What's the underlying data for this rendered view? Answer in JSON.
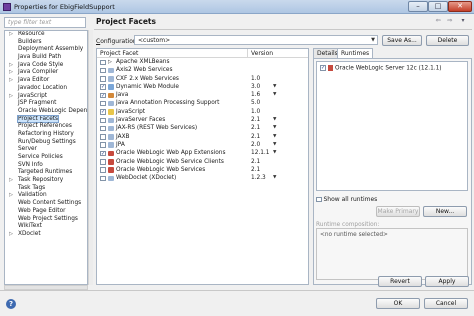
{
  "window": {
    "title": "Properties for EbigFieldSupport",
    "min": "–",
    "max": "□",
    "close": "✕"
  },
  "filter": {
    "placeholder": "type filter text"
  },
  "nav": {
    "items": [
      {
        "label": "Resource",
        "twisty": "▷"
      },
      {
        "label": "Builders",
        "twisty": ""
      },
      {
        "label": "Deployment Assembly",
        "twisty": ""
      },
      {
        "label": "Java Build Path",
        "twisty": ""
      },
      {
        "label": "Java Code Style",
        "twisty": "▷"
      },
      {
        "label": "Java Compiler",
        "twisty": "▷"
      },
      {
        "label": "Java Editor",
        "twisty": "▷"
      },
      {
        "label": "Javadoc Location",
        "twisty": ""
      },
      {
        "label": "JavaScript",
        "twisty": "▷"
      },
      {
        "label": "JSP Fragment",
        "twisty": ""
      },
      {
        "label": "Oracle WebLogic Depender",
        "twisty": ""
      },
      {
        "label": "Project Facets",
        "twisty": "",
        "selected": true
      },
      {
        "label": "Project References",
        "twisty": ""
      },
      {
        "label": "Refactoring History",
        "twisty": ""
      },
      {
        "label": "Run/Debug Settings",
        "twisty": ""
      },
      {
        "label": "Server",
        "twisty": ""
      },
      {
        "label": "Service Policies",
        "twisty": ""
      },
      {
        "label": "SVN Info",
        "twisty": ""
      },
      {
        "label": "Targeted Runtimes",
        "twisty": ""
      },
      {
        "label": "Task Repository",
        "twisty": "▷"
      },
      {
        "label": "Task Tags",
        "twisty": ""
      },
      {
        "label": "Validation",
        "twisty": "▷"
      },
      {
        "label": "Web Content Settings",
        "twisty": ""
      },
      {
        "label": "Web Page Editor",
        "twisty": ""
      },
      {
        "label": "Web Project Settings",
        "twisty": ""
      },
      {
        "label": "WikiText",
        "twisty": ""
      },
      {
        "label": "XDoclet",
        "twisty": "▷"
      }
    ]
  },
  "header": {
    "title": "Project Facets",
    "back_icon": "⇦",
    "forward_icon": "⇨",
    "menu_icon": "▾"
  },
  "configuration": {
    "label_prefix": "C",
    "label_rest": "onfiguration:",
    "value": "<custom>",
    "arrow": "▼",
    "save_as": "Save As...",
    "delete": "Delete"
  },
  "facets": {
    "col_facet": "Project Facet",
    "col_version": "Version",
    "rows": [
      {
        "expander": "▷",
        "checked": false,
        "icon": "",
        "name": "Apache XMLBeans",
        "version": "",
        "dd": ""
      },
      {
        "expander": "",
        "checked": false,
        "icon": "",
        "name": "Axis2 Web Services",
        "version": "",
        "dd": ""
      },
      {
        "expander": "",
        "checked": false,
        "icon": "",
        "name": "CXF 2.x Web Services",
        "version": "1.0",
        "dd": ""
      },
      {
        "expander": "",
        "checked": true,
        "icon": "web",
        "name": "Dynamic Web Module",
        "version": "3.0",
        "dd": "▼"
      },
      {
        "expander": "",
        "checked": true,
        "icon": "java",
        "name": "Java",
        "version": "1.6",
        "dd": "▼"
      },
      {
        "expander": "",
        "checked": false,
        "icon": "",
        "name": "Java Annotation Processing Support",
        "version": "5.0",
        "dd": ""
      },
      {
        "expander": "",
        "checked": true,
        "icon": "js",
        "name": "JavaScript",
        "version": "1.0",
        "dd": ""
      },
      {
        "expander": "",
        "checked": false,
        "icon": "",
        "name": "JavaServer Faces",
        "version": "2.1",
        "dd": "▼"
      },
      {
        "expander": "",
        "checked": false,
        "icon": "",
        "name": "JAX-RS (REST Web Services)",
        "version": "2.1",
        "dd": "▼"
      },
      {
        "expander": "",
        "checked": false,
        "icon": "",
        "name": "JAXB",
        "version": "2.1",
        "dd": "▼"
      },
      {
        "expander": "",
        "checked": false,
        "icon": "",
        "name": "JPA",
        "version": "2.0",
        "dd": "▼"
      },
      {
        "expander": "",
        "checked": true,
        "icon": "ora",
        "name": "Oracle WebLogic Web App Extensions",
        "version": "12.1.1",
        "dd": "▼"
      },
      {
        "expander": "",
        "checked": false,
        "icon": "ora",
        "name": "Oracle WebLogic Web Service Clients",
        "version": "2.1",
        "dd": ""
      },
      {
        "expander": "",
        "checked": false,
        "icon": "ora",
        "name": "Oracle WebLogic Web Services",
        "version": "2.1",
        "dd": ""
      },
      {
        "expander": "",
        "checked": false,
        "icon": "",
        "name": "WebDoclet (XDoclet)",
        "version": "1.2.3",
        "dd": "▼"
      }
    ]
  },
  "tabs": {
    "details": "Details",
    "runtimes": "Runtimes"
  },
  "runtimes": {
    "items": [
      {
        "checked": true,
        "label": "Oracle WebLogic Server 12c (12.1.1)"
      }
    ],
    "show_all": "Show all runtimes",
    "make_primary": "Make Primary",
    "new": "New...",
    "composition_label": "Runtime composition:",
    "composition_value": "<no runtime selected>"
  },
  "footer": {
    "help": "?",
    "revert": "Revert",
    "apply": "Apply",
    "ok": "OK",
    "cancel": "Cancel"
  },
  "check_mark": "✓"
}
